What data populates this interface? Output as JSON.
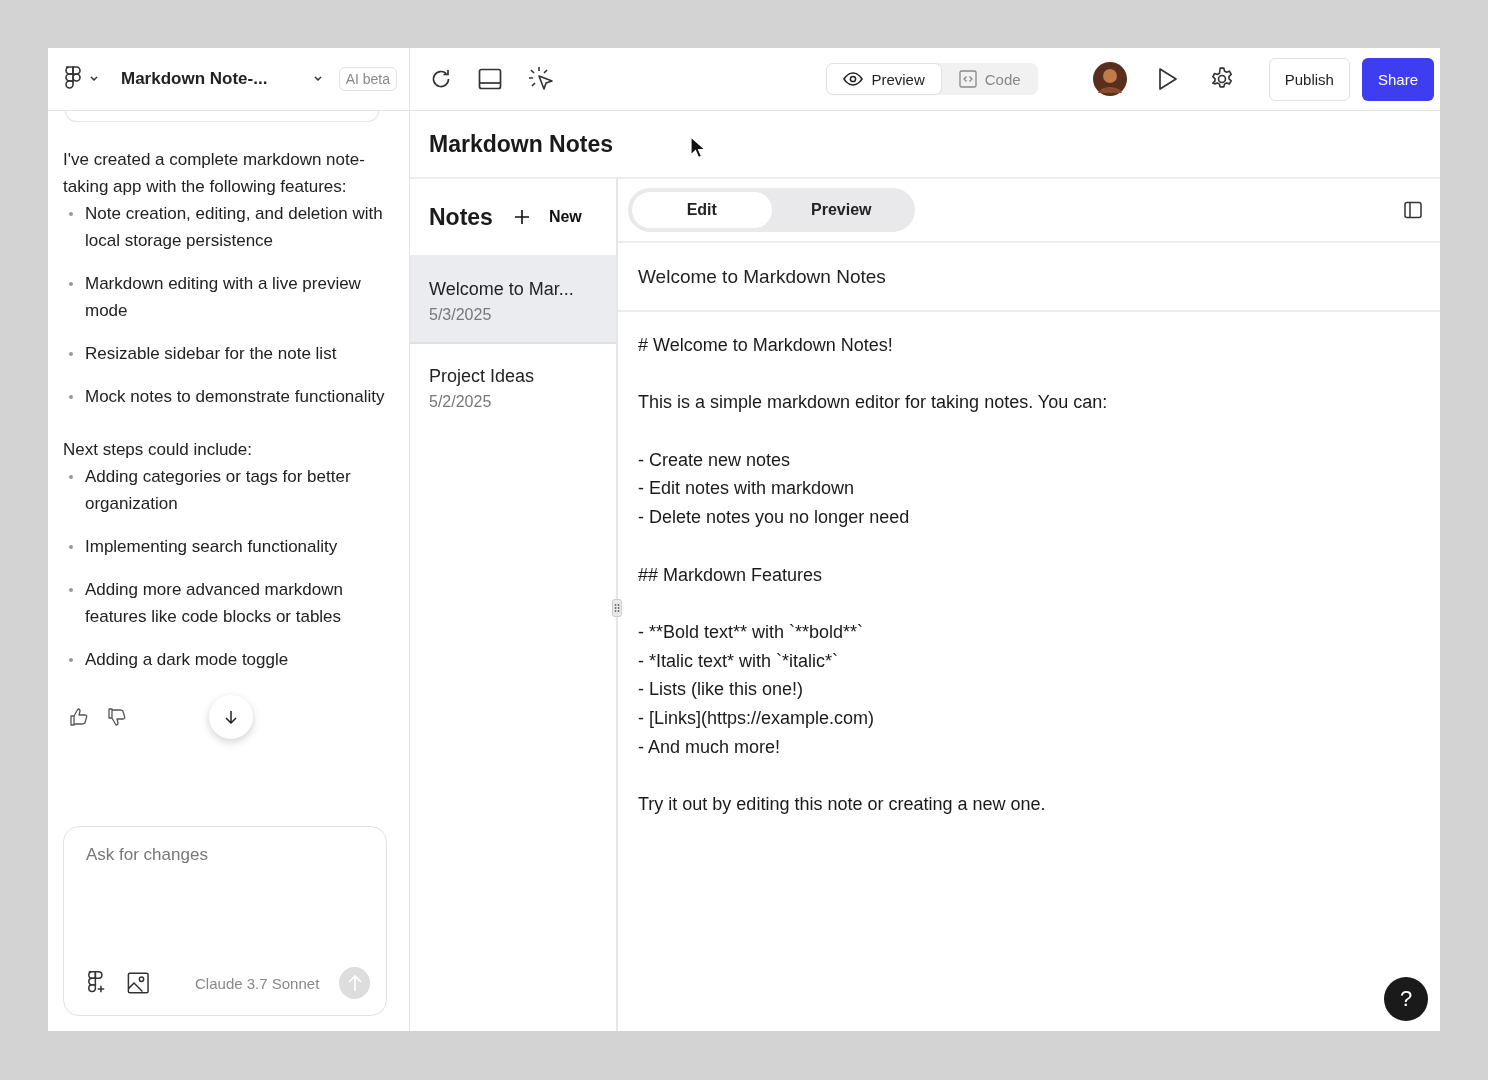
{
  "toolbar": {
    "project_title": "Markdown Note-...",
    "badge": "AI beta",
    "view_toggle": [
      {
        "label": "Preview",
        "kind": "eye",
        "selected": true
      },
      {
        "label": "Code",
        "kind": "code",
        "selected": false
      }
    ],
    "publish": "Publish",
    "share": "Share"
  },
  "chat": {
    "intro": "I've created a complete markdown note-taking app with the following features:",
    "features": [
      "Note creation, editing, and deletion with local storage persistence",
      "Markdown editing with a live preview mode",
      "Resizable sidebar for the note list",
      "Mock notes to demonstrate functionality"
    ],
    "next_heading": "Next steps could include:",
    "next_steps": [
      "Adding categories or tags for better organization",
      "Implementing search functionality",
      "Adding more advanced markdown features like code blocks or tables",
      "Adding a dark mode toggle"
    ],
    "input": {
      "placeholder": "Ask for changes"
    },
    "model": "Claude 3.7 Sonnet"
  },
  "app": {
    "title": "Markdown Notes",
    "notes_heading": "Notes",
    "new_button": "New",
    "notes": [
      {
        "title": "Welcome to Mar...",
        "date": "5/3/2025",
        "selected": true
      },
      {
        "title": "Project Ideas",
        "date": "5/2/2025",
        "selected": false
      }
    ],
    "mode_tabs": [
      {
        "label": "Edit",
        "selected": true
      },
      {
        "label": "Preview",
        "selected": false
      }
    ],
    "note_title": "Welcome to Markdown Notes",
    "content": [
      [
        "# Welcome to Markdown Notes!"
      ],
      [
        "This is a simple markdown editor for taking notes. You can:"
      ],
      [
        "- Create new notes",
        "- Edit notes with markdown",
        "- Delete notes you no longer need"
      ],
      [
        "## Markdown Features"
      ],
      [
        "- **Bold text** with `**bold**`",
        "- *Italic text* with `*italic*`",
        "- Lists (like this one!)",
        "- [Links](https://example.com)",
        "- And much more!"
      ],
      [
        "Try it out by editing this note or creating a new one."
      ]
    ]
  },
  "help_button": "?"
}
